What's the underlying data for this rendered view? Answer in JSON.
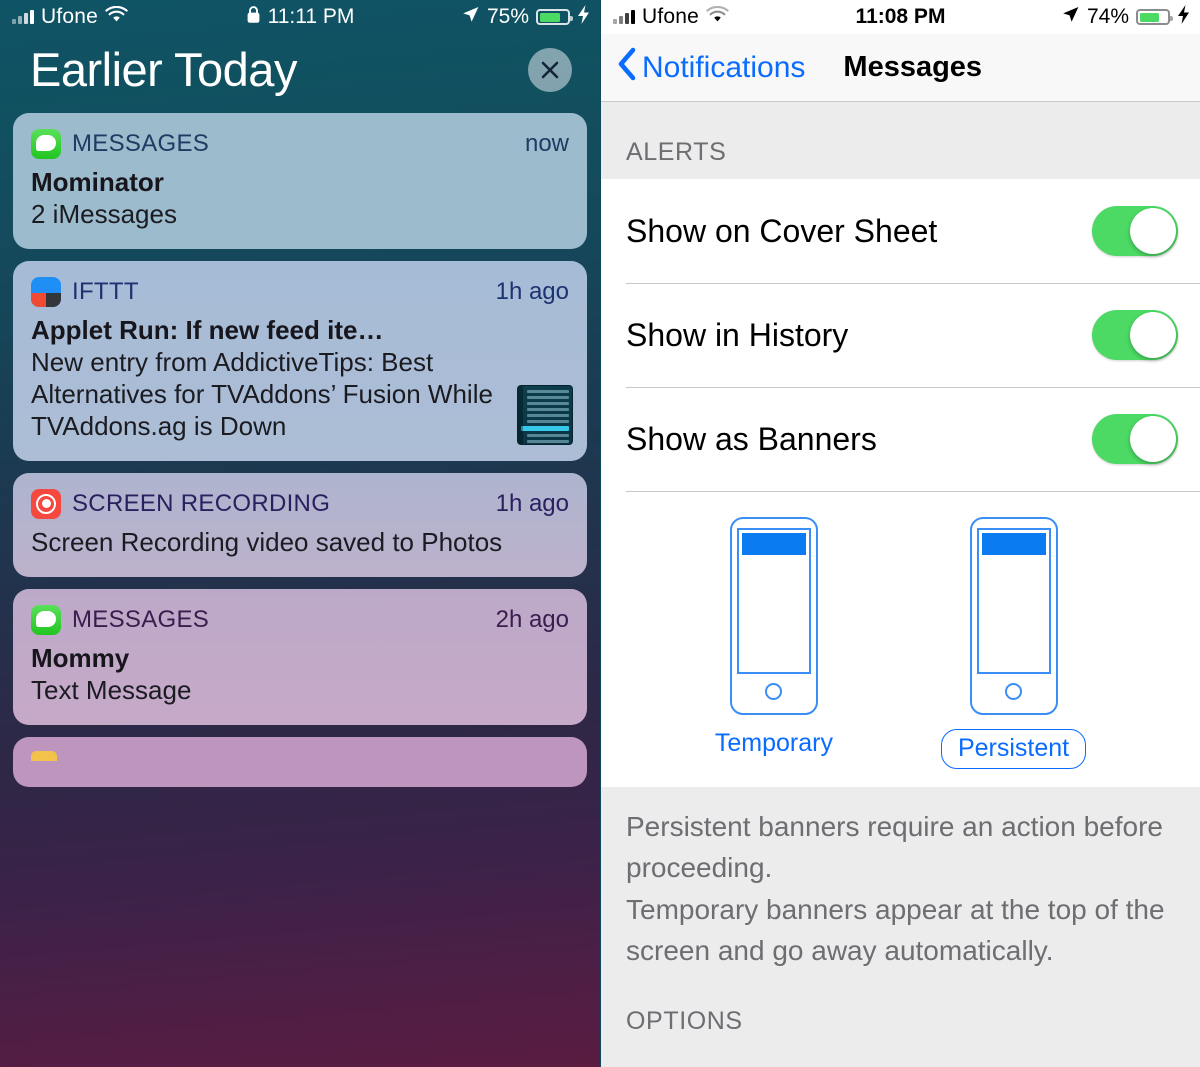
{
  "left": {
    "status_bar": {
      "carrier": "Ufone",
      "wifi_icon": "wifi-icon",
      "signal_icon": "cellular-signal-icon",
      "lock_icon": "lock-icon",
      "time": "11:11 PM",
      "location_icon": "location-arrow-icon",
      "battery_percent": "75%",
      "battery_icon": "battery-icon",
      "charging_icon": "lightning-bolt-icon"
    },
    "header": {
      "title": "Earlier Today",
      "close_icon": "close-x-icon"
    },
    "notifications": [
      {
        "app": "MESSAGES",
        "icon": "messages-app-icon",
        "time": "now",
        "title": "Mominator",
        "body": "2 iMessages",
        "style": "c1",
        "has_thumbnail": false
      },
      {
        "app": "IFTTT",
        "icon": "ifttt-app-icon",
        "time": "1h ago",
        "title": "Applet Run: If new feed ite…",
        "body": "New entry from AddictiveTips: Best Alternatives for TVAddons’ Fusion While TVAddons.ag is Down",
        "style": "c2",
        "has_thumbnail": true
      },
      {
        "app": "SCREEN RECORDING",
        "icon": "screen-recording-app-icon",
        "time": "1h ago",
        "title": "",
        "body": "Screen Recording video saved to Photos",
        "style": "c3",
        "has_thumbnail": false
      },
      {
        "app": "MESSAGES",
        "icon": "messages-app-icon",
        "time": "2h ago",
        "title": "Mommy",
        "body": "Text Message",
        "style": "c4",
        "has_thumbnail": false
      }
    ]
  },
  "right": {
    "status_bar": {
      "carrier": "Ufone",
      "wifi_icon": "wifi-icon",
      "signal_icon": "cellular-signal-icon",
      "time": "11:08 PM",
      "location_icon": "location-arrow-icon",
      "battery_percent": "74%",
      "battery_icon": "battery-icon",
      "charging_icon": "lightning-bolt-icon"
    },
    "navbar": {
      "back_label": "Notifications",
      "back_icon": "chevron-left-icon",
      "title": "Messages"
    },
    "alerts_section": {
      "header": "ALERTS",
      "rows": [
        {
          "label": "Show on Cover Sheet",
          "toggle_on": true
        },
        {
          "label": "Show in History",
          "toggle_on": true
        },
        {
          "label": "Show as Banners",
          "toggle_on": true
        }
      ]
    },
    "banner_style": {
      "options": [
        {
          "label": "Temporary",
          "selected": false,
          "icon": "iphone-banner-preview-icon"
        },
        {
          "label": "Persistent",
          "selected": true,
          "icon": "iphone-banner-preview-icon"
        }
      ]
    },
    "footer_note": {
      "line1": "Persistent banners require an action before proceeding.",
      "line2": "Temporary banners appear at the top of the screen and go away automatically."
    },
    "options_section": {
      "header": "OPTIONS"
    }
  },
  "colors": {
    "ios_blue": "#0a6cff",
    "toggle_green": "#4cd964",
    "section_gray": "#6d6d72",
    "separator": "#c8c7cc",
    "lockscreen_top": "#0f5466",
    "lockscreen_bottom": "#5a1c41"
  }
}
